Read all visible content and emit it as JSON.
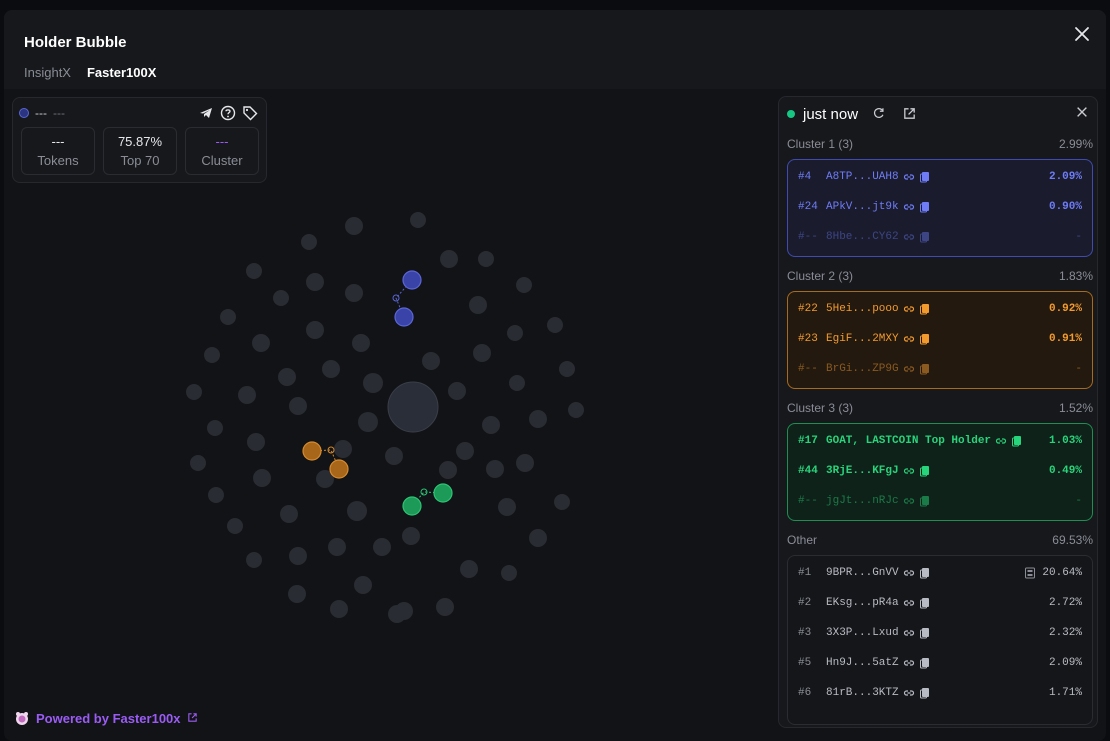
{
  "header": {
    "title": "Holder Bubble",
    "tabs": [
      "InsightX",
      "Faster100X"
    ]
  },
  "info_card": {
    "name": "---",
    "sub": "---",
    "stats": [
      {
        "value": "---",
        "label": "Tokens"
      },
      {
        "value": "75.87%",
        "label": "Top 70"
      },
      {
        "value": "---",
        "label": "Cluster"
      }
    ]
  },
  "powered": {
    "text": "Powered by Faster100x"
  },
  "panel": {
    "time": "just now",
    "clusters": [
      {
        "name": "Cluster 1 (3)",
        "pct": "2.99%",
        "color": "#6f7cf5",
        "rows": [
          {
            "rank": "#4",
            "addr": "A8TP...UAH8",
            "pct": "2.09%"
          },
          {
            "rank": "#24",
            "addr": "APkV...jt9k",
            "pct": "0.90%"
          },
          {
            "rank": "#--",
            "addr": "8Hbe...CY62",
            "pct": "-"
          }
        ]
      },
      {
        "name": "Cluster 2 (3)",
        "pct": "1.83%",
        "color": "#f29a2e",
        "rows": [
          {
            "rank": "#22",
            "addr": "5Hei...pooo",
            "pct": "0.92%"
          },
          {
            "rank": "#23",
            "addr": "EgiF...2MXY",
            "pct": "0.91%"
          },
          {
            "rank": "#--",
            "addr": "BrGi...ZP9G",
            "pct": "-"
          }
        ]
      },
      {
        "name": "Cluster 3 (3)",
        "pct": "1.52%",
        "color": "#28d47b",
        "rows": [
          {
            "rank": "#17",
            "addr": "GOAT, LASTCOIN Top Holder",
            "pct": "1.03%"
          },
          {
            "rank": "#44",
            "addr": "3RjE...KFgJ",
            "pct": "0.49%"
          },
          {
            "rank": "#--",
            "addr": "jgJt...nRJc",
            "pct": "-"
          }
        ]
      }
    ],
    "other": {
      "name": "Other",
      "pct": "69.53%",
      "rows": [
        {
          "rank": "#1",
          "addr": "9BPR...GnVV",
          "pct": "20.64%"
        },
        {
          "rank": "#2",
          "addr": "EKsg...pR4a",
          "pct": "2.72%"
        },
        {
          "rank": "#3",
          "addr": "3X3P...Lxud",
          "pct": "2.32%"
        },
        {
          "rank": "#5",
          "addr": "Hn9J...5atZ",
          "pct": "2.09%"
        },
        {
          "rank": "#6",
          "addr": "81rB...3KTZ",
          "pct": "1.71%"
        }
      ]
    }
  },
  "colors": {
    "bubble_gray": "#2a2c33",
    "cluster_blue": "#3a44a8",
    "cluster_orange": "#a8661a",
    "cluster_green": "#1d9a58"
  }
}
